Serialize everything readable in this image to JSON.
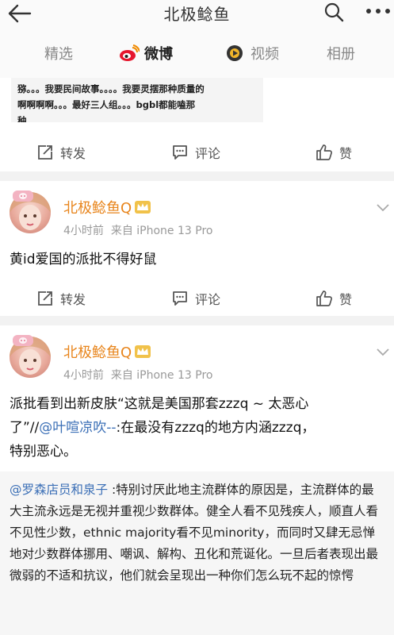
{
  "header": {
    "title": "北极鲶鱼"
  },
  "tabs": [
    {
      "label": "精选"
    },
    {
      "label": "微博"
    },
    {
      "label": "视频"
    },
    {
      "label": "相册"
    }
  ],
  "top_card": {
    "quote_lines": [
      "猕。。。我要民间故事。。。。我要灵摆那种质量的",
      "啊啊啊啊。。。最好三人组。。。bgbl都能嗑那",
      "种"
    ]
  },
  "actions": {
    "repost": "转发",
    "comment": "评论",
    "like": "赞"
  },
  "post1": {
    "username": "北极鲶鱼Q",
    "time": "4小时前",
    "source": "来自 iPhone 13 Pro",
    "text": "黄id爱国的派批不得好鼠"
  },
  "post2": {
    "username": "北极鲶鱼Q",
    "time": "4小时前",
    "source": "来自 iPhone 13 Pro",
    "text_line1": "派批看到出新皮肤“这就是美国那套zzzq ~ 太恶心",
    "text_line2_a": "了”//",
    "text_line2_mention": "@叶喧凉吹--",
    "text_line2_b": ":在最没有zzzq的地方内涵zzzq，",
    "text_line3": "特别恶心。",
    "quoted_mention": "@罗森店员和泉子",
    "quoted_text": " :特别讨厌此地主流群体的原因是，主流群体的最大主流永远是无视并重视少数群体。健全人看不见残疾人，顺直人看不见性少数，ethnic majority看不见minority，而同时又肆无忌惮地对少数群体挪用、嘲讽、解构、丑化和荒诞化。一旦后者表现出最微弱的不适和抗议，他们就会呈现出一种你们怎么玩不起的惊愕"
  },
  "colors": {
    "username": "#e8851c",
    "mention": "#3b6fb6",
    "weibo_red": "#e6162d"
  }
}
